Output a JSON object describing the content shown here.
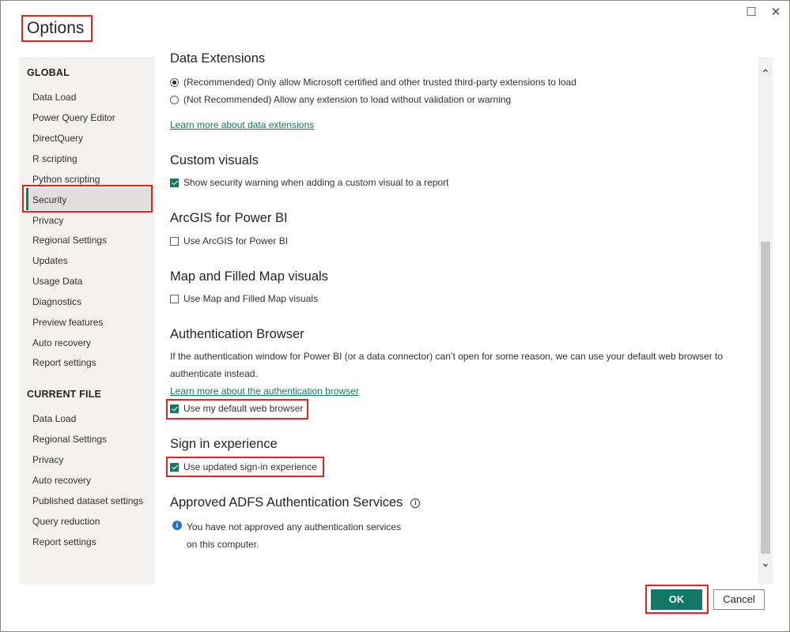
{
  "title": "Options",
  "window": {
    "maximize_icon": "maximize-icon",
    "close_icon": "close-icon"
  },
  "sidebar": {
    "global_heading": "GLOBAL",
    "global_items": [
      "Data Load",
      "Power Query Editor",
      "DirectQuery",
      "R scripting",
      "Python scripting",
      "Security",
      "Privacy",
      "Regional Settings",
      "Updates",
      "Usage Data",
      "Diagnostics",
      "Preview features",
      "Auto recovery",
      "Report settings"
    ],
    "selected": "Security",
    "current_heading": "CURRENT FILE",
    "current_items": [
      "Data Load",
      "Regional Settings",
      "Privacy",
      "Auto recovery",
      "Published dataset settings",
      "Query reduction",
      "Report settings"
    ]
  },
  "content": {
    "data_extensions": {
      "heading": "Data Extensions",
      "radio_recommended": "(Recommended) Only allow Microsoft certified and other trusted third-party extensions to load",
      "radio_not_recommended": "(Not Recommended) Allow any extension to load without validation or warning",
      "link": "Learn more about data extensions"
    },
    "custom_visuals": {
      "heading": "Custom visuals",
      "checkbox": "Show security warning when adding a custom visual to a report"
    },
    "arcgis": {
      "heading": "ArcGIS for Power BI",
      "checkbox": "Use ArcGIS for Power BI"
    },
    "map": {
      "heading": "Map and Filled Map visuals",
      "checkbox": "Use Map and Filled Map visuals"
    },
    "auth_browser": {
      "heading": "Authentication Browser",
      "description": "If the authentication window for Power BI (or a data connector) can’t open for some reason, we can use your default web browser to authenticate instead.",
      "link": "Learn more about the authentication browser",
      "checkbox": "Use my default web browser"
    },
    "sign_in": {
      "heading": "Sign in experience",
      "checkbox": "Use updated sign-in experience"
    },
    "adfs": {
      "heading": "Approved ADFS Authentication Services",
      "message_line1": "You have not approved any authentication services",
      "message_line2": "on this computer."
    }
  },
  "buttons": {
    "ok": "OK",
    "cancel": "Cancel"
  },
  "colors": {
    "accent": "#117865",
    "highlight": "#d9281f"
  }
}
